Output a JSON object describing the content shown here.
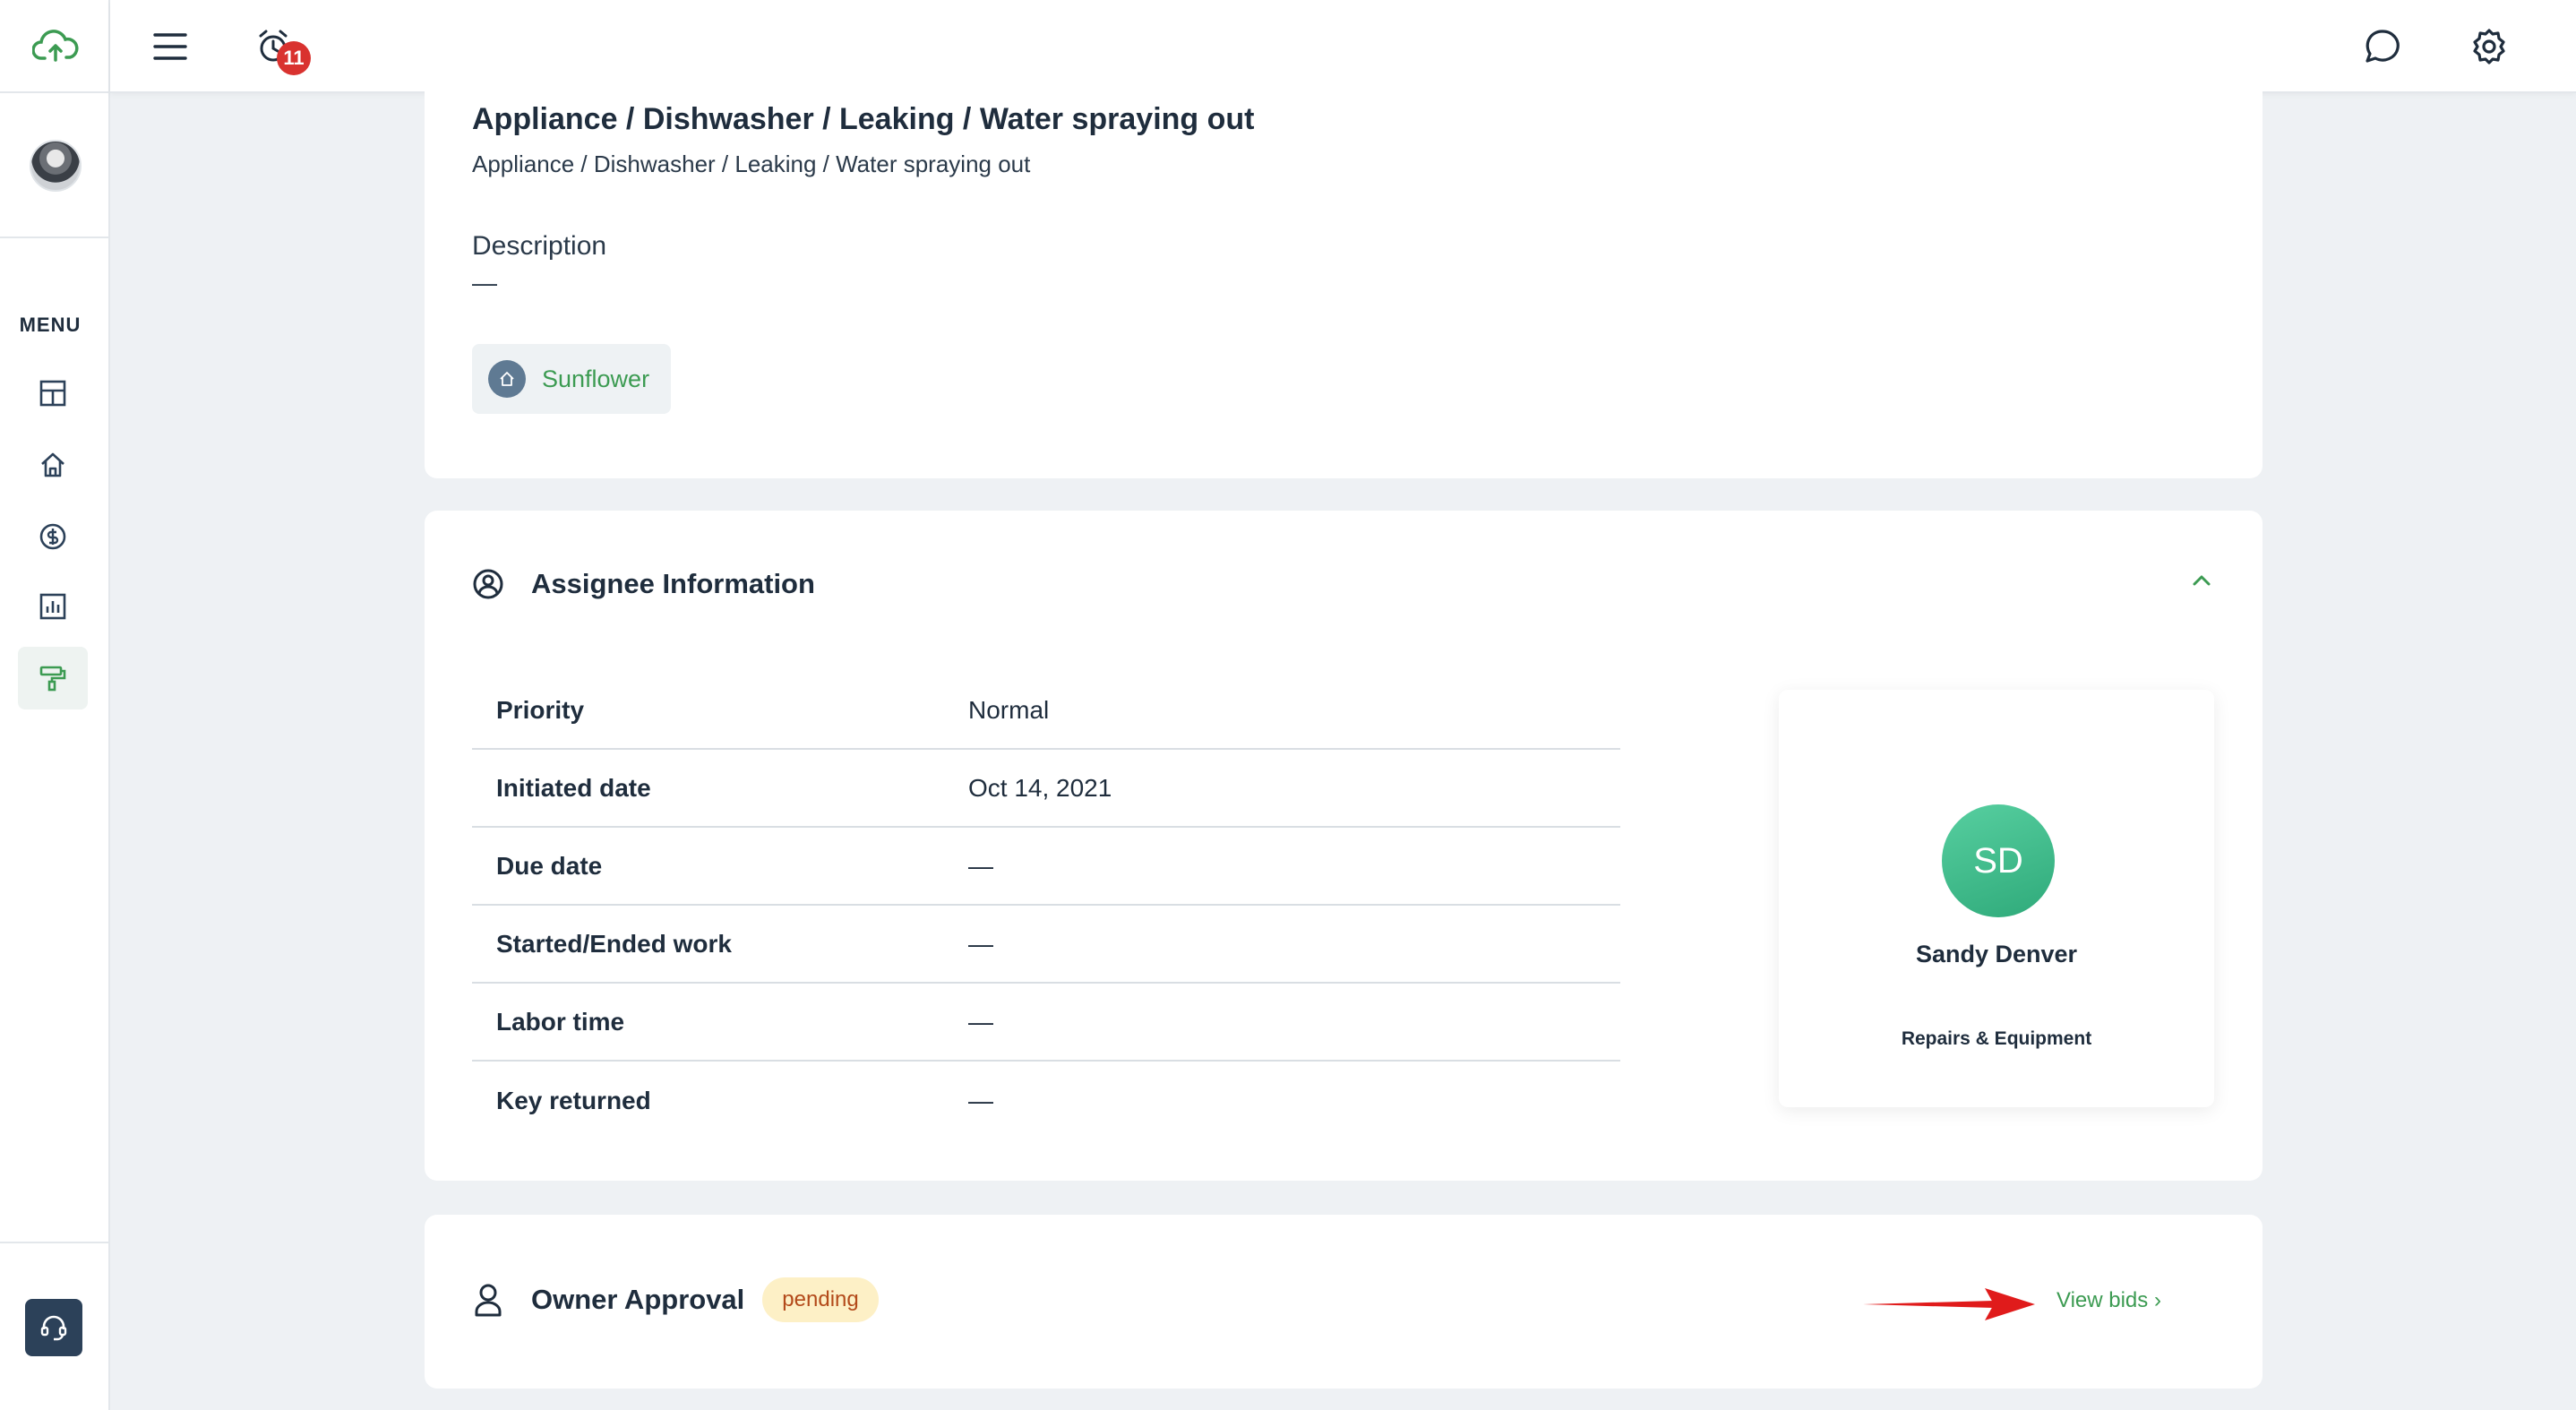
{
  "topbar": {
    "notification_count": "11"
  },
  "sidebar": {
    "menu_label": "MENU",
    "items": [
      {
        "icon": "dashboard-icon"
      },
      {
        "icon": "home-icon"
      },
      {
        "icon": "dollar-icon"
      },
      {
        "icon": "chart-icon"
      },
      {
        "icon": "paint-roller-icon",
        "active": true
      }
    ]
  },
  "request": {
    "title": "Appliance / Dishwasher / Leaking / Water spraying out",
    "subtitle": "Appliance / Dishwasher / Leaking / Water spraying out",
    "description_label": "Description",
    "description_value": "—",
    "property_chip": "Sunflower"
  },
  "assignee": {
    "section_title": "Assignee Information",
    "rows": [
      {
        "label": "Priority",
        "value": "Normal"
      },
      {
        "label": "Initiated date",
        "value": "Oct 14, 2021"
      },
      {
        "label": "Due date",
        "value": "—"
      },
      {
        "label": "Started/Ended work",
        "value": "—"
      },
      {
        "label": "Labor time",
        "value": "—"
      },
      {
        "label": "Key returned",
        "value": "—"
      }
    ],
    "initials": "SD",
    "name": "Sandy Denver",
    "role": "Repairs & Equipment"
  },
  "owner_approval": {
    "title": "Owner Approval",
    "status": "pending",
    "link": "View bids ›"
  },
  "colors": {
    "accent_green": "#3c9b52",
    "badge_red": "#d9322f",
    "arrow_red": "#e01b1b"
  }
}
